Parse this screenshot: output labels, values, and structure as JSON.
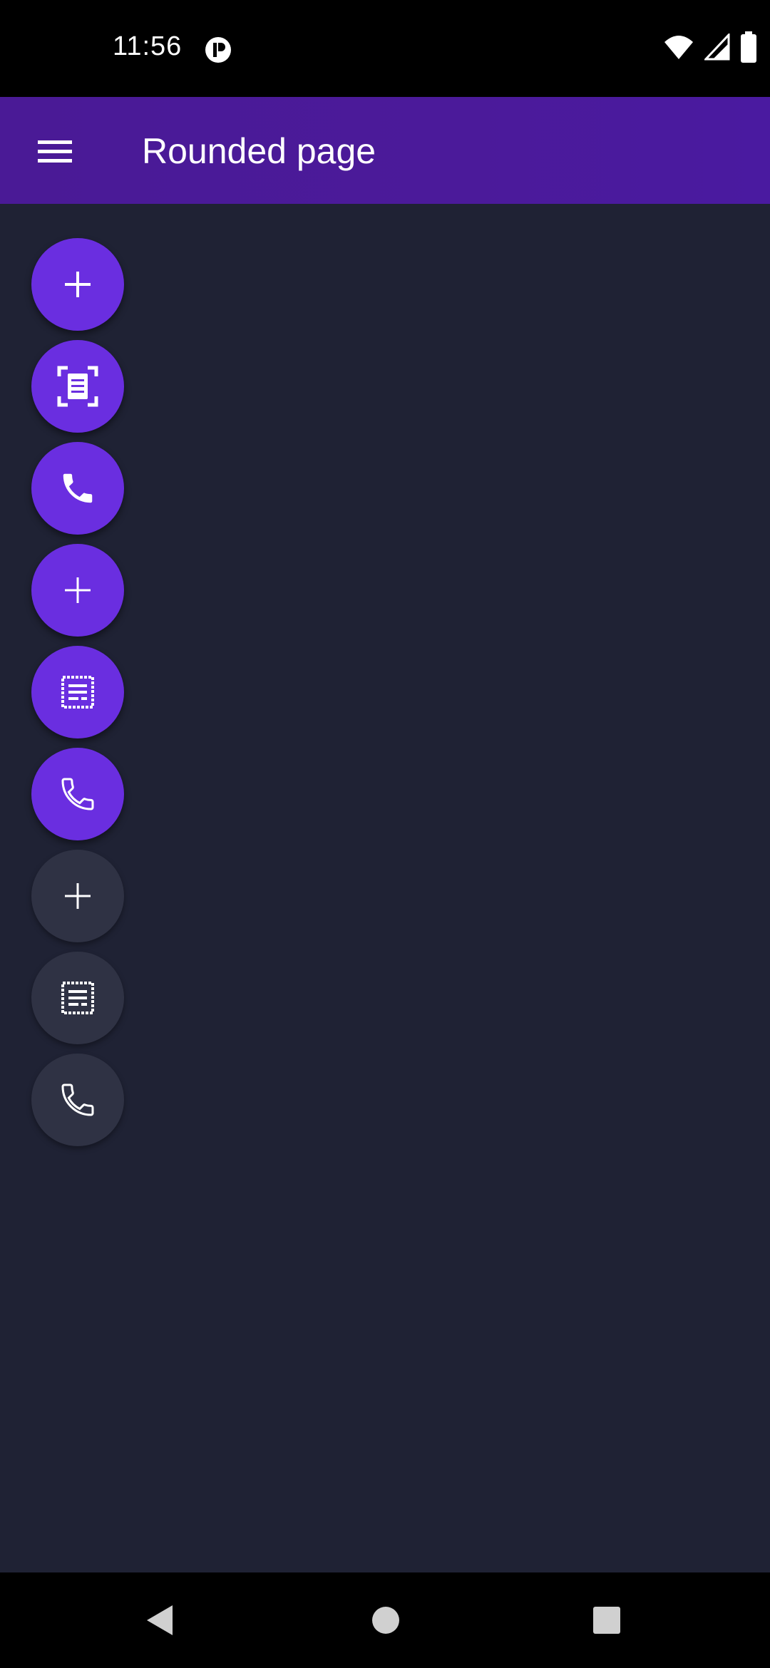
{
  "status_bar": {
    "time": "11:56",
    "icons": [
      "app-notification-icon",
      "wifi-icon",
      "cellular-signal-icon",
      "battery-icon"
    ]
  },
  "app_bar": {
    "title": "Rounded page",
    "menu_icon": "hamburger-menu-icon"
  },
  "fabs": [
    {
      "icon": "plus-icon",
      "style": "filled",
      "color": "#6a2ee0"
    },
    {
      "icon": "document-scanner-icon",
      "style": "filled",
      "color": "#6a2ee0"
    },
    {
      "icon": "phone-icon",
      "style": "filled",
      "color": "#6a2ee0"
    },
    {
      "icon": "plus-icon",
      "style": "filled",
      "color": "#6a2ee0"
    },
    {
      "icon": "receipt-icon",
      "style": "outlined",
      "color": "#6a2ee0"
    },
    {
      "icon": "phone-icon",
      "style": "outlined",
      "color": "#6a2ee0"
    },
    {
      "icon": "plus-icon",
      "style": "outlined",
      "color": "#2f3244"
    },
    {
      "icon": "receipt-icon",
      "style": "outlined",
      "color": "#2f3244"
    },
    {
      "icon": "phone-icon",
      "style": "outlined",
      "color": "#2f3244"
    }
  ],
  "navigation_bar": {
    "buttons": [
      "back-icon",
      "home-icon",
      "recents-icon"
    ]
  },
  "colors": {
    "app_bar": "#4b1a9a",
    "background": "#1f2234",
    "fab_accent": "#6a2ee0",
    "fab_inactive": "#2f3244"
  }
}
